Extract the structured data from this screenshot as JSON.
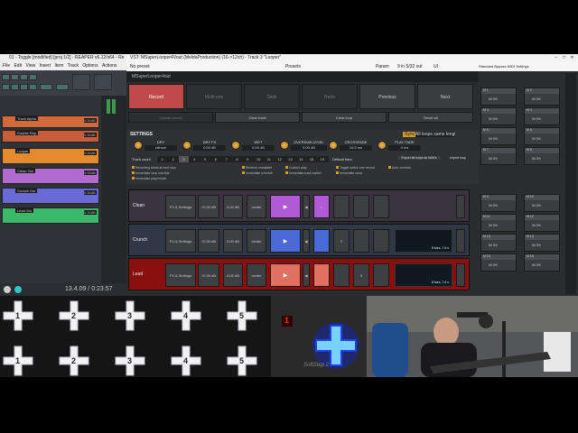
{
  "reaper_window": {
    "title": "01 - Toggle [modified] [proj 1/2] - REAPER v6.12/x64 - Re",
    "menu": [
      "File",
      "Edit",
      "View",
      "Insert",
      "Item",
      "Track",
      "Options",
      "Actions"
    ],
    "tracks": [
      {
        "name": "Track Alpha",
        "vol": "0.00dB",
        "color": "#d36a3a"
      },
      {
        "name": "Double Rep",
        "vol": "0.00dB",
        "color": "#c85d3a"
      },
      {
        "name": "Looper",
        "vol": "0.00dB",
        "color": "#e68a2e"
      },
      {
        "name": "Clean Gui",
        "vol": "0.00dB",
        "color": "#b06ad0"
      },
      {
        "name": "Crunch Gui",
        "vol": "0.00dB",
        "color": "#6a6ad8"
      },
      {
        "name": "Lead Gui",
        "vol": "0.00dB",
        "color": "#3cb86a"
      }
    ],
    "transport_time": "13.4.09 / 0:23.57"
  },
  "plugin": {
    "title": "VST: MSuperLooper4Vout (MeldaProduction) (16->12ch) - Track 3 \"Looper\"",
    "preset": "No preset",
    "presets_label": "Presets",
    "param_label": "Param",
    "io_label": "9 in 5/32 out",
    "ui_label": "UI",
    "header": "MSuperLooper4out",
    "top_buttons": {
      "record": "Record",
      "multi": "Multi-one",
      "slide": "Slide",
      "redo": "Redo",
      "previous": "Previous",
      "next": "Next",
      "cancel_record": "Cancel record",
      "clear_track": "Clear track",
      "clear_loop": "Clear loop",
      "reset_all": "Reset all"
    },
    "settings": {
      "title": "SETTINGS",
      "sync_label": "Sync",
      "sync_value": "All loops same length",
      "params": [
        {
          "label": "DRY",
          "value": "silence"
        },
        {
          "label": "DRY FX",
          "value": "0.00 dB"
        },
        {
          "label": "WET",
          "value": "0.00 dB"
        },
        {
          "label": "OVERDUB LEVEL",
          "value": "0.00 dB"
        },
        {
          "label": "CROSSFADE",
          "value": "10.0 ms"
        },
        {
          "label": "PLAY FADE",
          "value": "0 ms"
        }
      ],
      "track_count_label": "Track count",
      "track_numbers": [
        "1",
        "2",
        "3",
        "4",
        "5",
        "6",
        "7",
        "8",
        "9",
        "10",
        "11",
        "12",
        "13",
        "14",
        "15",
        "16"
      ],
      "default_bars_label": "Default bars",
      "export_btn": "Export all loops as WAVs",
      "import_btn": "Import loop",
      "options": [
        "Recording starts at next loop",
        "Immediate loop overdub",
        "Immediate playl mode",
        "Reverse crossfade",
        "Immediate overdub",
        "Custom play",
        "Immediate track switch",
        "Toggle switch one record",
        "Immediate clear",
        "Auto overdub"
      ]
    },
    "loops": [
      {
        "name": "Clean",
        "fx": "FX & Settings",
        "v1": "+0.00 dB",
        "v2": "0.00 dB",
        "pan": "center",
        "num": "1",
        "bg": "#3a3440",
        "pad": "#b05ad8"
      },
      {
        "name": "Crunch",
        "fx": "FX & Settings",
        "v1": "+0.00 dB",
        "v2": "0.00 dB",
        "pan": "center",
        "num": "2",
        "bg": "#303848",
        "pad": "#4a6ad8",
        "wave_label": "5 bars, 7.6 s"
      },
      {
        "name": "Lead",
        "fx": "FX & Settings",
        "v1": "+0.00 dB",
        "v2": "0.00 dB",
        "pan": "center",
        "num": "3",
        "bg": "#8a1010",
        "pad": "#e07060",
        "wave_label": "5 bars, 7.6 s"
      }
    ]
  },
  "side_panel": {
    "top_items": [
      "Standard",
      "Bypass",
      "MIDI",
      "Settings"
    ],
    "slots": [
      {
        "name": "M 1",
        "value": "50.0%"
      },
      {
        "name": "M 2",
        "value": "50.0%"
      },
      {
        "name": "M 3",
        "value": "50.0%"
      },
      {
        "name": "M 4",
        "value": "50.0%"
      },
      {
        "name": "M 5",
        "value": "50.0%"
      },
      {
        "name": "M 6",
        "value": "50.0%"
      },
      {
        "name": "M 7",
        "value": "50.0%"
      },
      {
        "name": "M 8",
        "value": "50.0%"
      },
      {
        "name": "M 9",
        "value": "50.0%"
      },
      {
        "name": "M 10",
        "value": "50.0%"
      },
      {
        "name": "M 11",
        "value": "50.0%"
      },
      {
        "name": "M 12",
        "value": "50.0%"
      },
      {
        "name": "M 13",
        "value": "50.0%"
      },
      {
        "name": "M 14",
        "value": "50.0%"
      },
      {
        "name": "M 15",
        "value": "50.0%"
      },
      {
        "name": "M 16",
        "value": "50.0%"
      }
    ]
  },
  "footswitch": {
    "pad_numbers": [
      "1",
      "2",
      "3",
      "4",
      "5",
      "1",
      "2",
      "3",
      "4",
      "5"
    ],
    "brand": "SoftStep 2",
    "led": "1"
  }
}
